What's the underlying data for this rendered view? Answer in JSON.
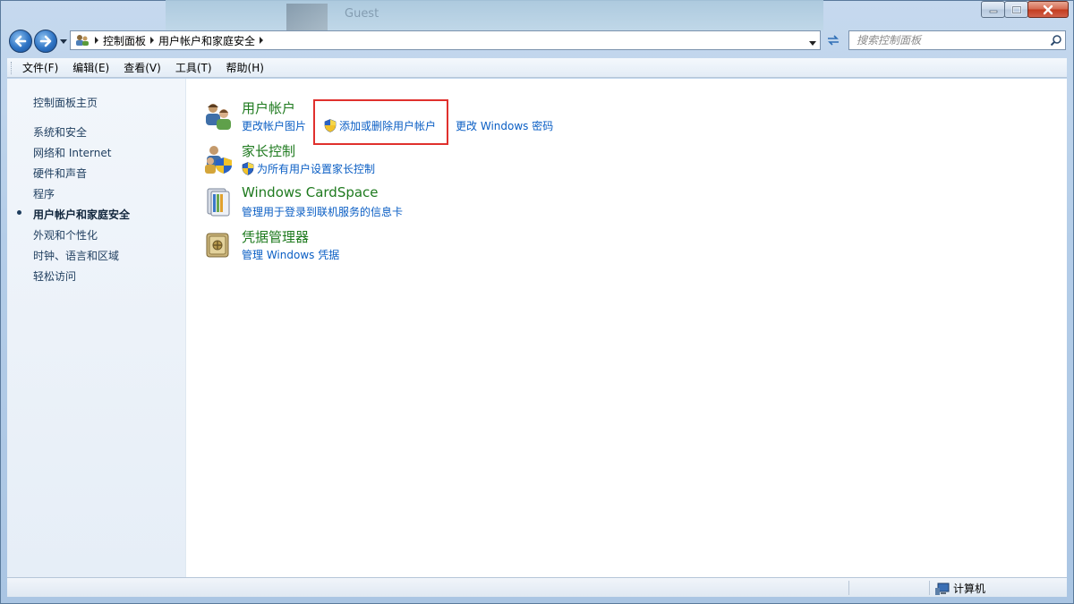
{
  "window": {
    "background_thumbnail_text": "Guest"
  },
  "address_bar": {
    "breadcrumbs": [
      "控制面板",
      "用户帐户和家庭安全"
    ]
  },
  "search": {
    "placeholder": "搜索控制面板"
  },
  "menu": {
    "items": [
      "文件(F)",
      "编辑(E)",
      "查看(V)",
      "工具(T)",
      "帮助(H)"
    ]
  },
  "sidebar": {
    "home": "控制面板主页",
    "items": [
      "系统和安全",
      "网络和 Internet",
      "硬件和声音",
      "程序",
      "用户帐户和家庭安全",
      "外观和个性化",
      "时钟、语言和区域",
      "轻松访问"
    ],
    "active_index": 4
  },
  "categories": [
    {
      "title": "用户帐户",
      "icon": "users-icon",
      "links": [
        "更改帐户图片",
        "添加或删除用户帐户",
        "更改 Windows 密码"
      ]
    },
    {
      "title": "家长控制",
      "icon": "parental-control-icon",
      "links": [
        "为所有用户设置家长控制"
      ]
    },
    {
      "title": "Windows CardSpace",
      "icon": "cardspace-icon",
      "links": [
        "管理用于登录到联机服务的信息卡"
      ]
    },
    {
      "title": "凭据管理器",
      "icon": "credential-vault-icon",
      "links": [
        "管理 Windows 凭据"
      ]
    }
  ],
  "status": {
    "location": "计算机"
  },
  "colors": {
    "category_title": "#1e7a1e",
    "link": "#0a5ec4",
    "highlight_box": "#e0302d"
  }
}
